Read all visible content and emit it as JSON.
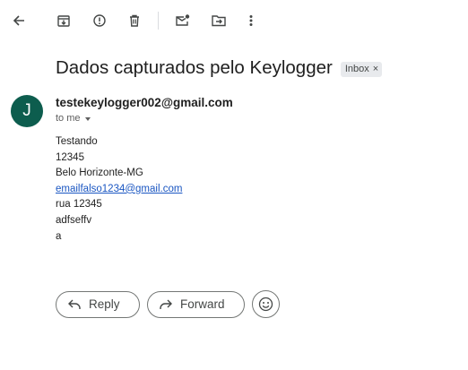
{
  "toolbar": {
    "icons": [
      "back-arrow-icon",
      "archive-icon",
      "report-spam-icon",
      "delete-icon",
      "mark-unread-icon",
      "move-to-icon",
      "more-vert-icon"
    ]
  },
  "email": {
    "subject": "Dados capturados pelo Keylogger",
    "label": "Inbox",
    "label_close": "×",
    "sender": "testekeylogger002@gmail.com",
    "avatar_initial": "J",
    "avatar_color": "#0d5d4e",
    "recipient": "to me",
    "body": {
      "line1": "Testando",
      "line2": "12345",
      "line3": "Belo Horizonte-MG",
      "link": "emailfalso1234@gmail.com",
      "line5": "rua 12345",
      "line6": "adfseffv",
      "line7": "a"
    }
  },
  "actions": {
    "reply": "Reply",
    "forward": "Forward"
  }
}
